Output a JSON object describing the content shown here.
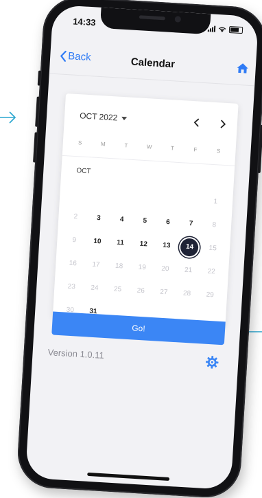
{
  "status_bar": {
    "time": "14:33"
  },
  "navbar": {
    "back_label": "Back",
    "title": "Calendar",
    "home_icon": "home-icon"
  },
  "calendar": {
    "month_select": "OCT 2022",
    "weekdays": [
      "S",
      "M",
      "T",
      "W",
      "T",
      "F",
      "S"
    ],
    "month_label": "OCT",
    "days": [
      {
        "d": "",
        "s": "blank"
      },
      {
        "d": "",
        "s": "blank"
      },
      {
        "d": "",
        "s": "blank"
      },
      {
        "d": "",
        "s": "blank"
      },
      {
        "d": "",
        "s": "blank"
      },
      {
        "d": "",
        "s": "blank"
      },
      {
        "d": "1",
        "s": "muted"
      },
      {
        "d": "2",
        "s": "muted"
      },
      {
        "d": "3",
        "s": "active"
      },
      {
        "d": "4",
        "s": "active"
      },
      {
        "d": "5",
        "s": "active"
      },
      {
        "d": "6",
        "s": "active"
      },
      {
        "d": "7",
        "s": "active"
      },
      {
        "d": "8",
        "s": "muted"
      },
      {
        "d": "9",
        "s": "muted"
      },
      {
        "d": "10",
        "s": "active"
      },
      {
        "d": "11",
        "s": "active"
      },
      {
        "d": "12",
        "s": "active"
      },
      {
        "d": "13",
        "s": "active"
      },
      {
        "d": "14",
        "s": "selected"
      },
      {
        "d": "15",
        "s": "muted"
      },
      {
        "d": "16",
        "s": "muted"
      },
      {
        "d": "17",
        "s": "muted"
      },
      {
        "d": "18",
        "s": "muted"
      },
      {
        "d": "19",
        "s": "muted"
      },
      {
        "d": "20",
        "s": "muted"
      },
      {
        "d": "21",
        "s": "muted"
      },
      {
        "d": "22",
        "s": "muted"
      },
      {
        "d": "23",
        "s": "muted"
      },
      {
        "d": "24",
        "s": "muted"
      },
      {
        "d": "25",
        "s": "muted"
      },
      {
        "d": "26",
        "s": "muted"
      },
      {
        "d": "27",
        "s": "muted"
      },
      {
        "d": "28",
        "s": "muted"
      },
      {
        "d": "29",
        "s": "muted"
      },
      {
        "d": "30",
        "s": "muted"
      },
      {
        "d": "31",
        "s": "active"
      }
    ],
    "selected_day": "14",
    "go_label": "Go!"
  },
  "footer": {
    "version": "Version 1.0.11",
    "settings_icon": "gear-icon"
  },
  "colors": {
    "accent": "#3b86f5",
    "selected": "#1f2336",
    "decor_arrow": "#2aa6cf"
  }
}
